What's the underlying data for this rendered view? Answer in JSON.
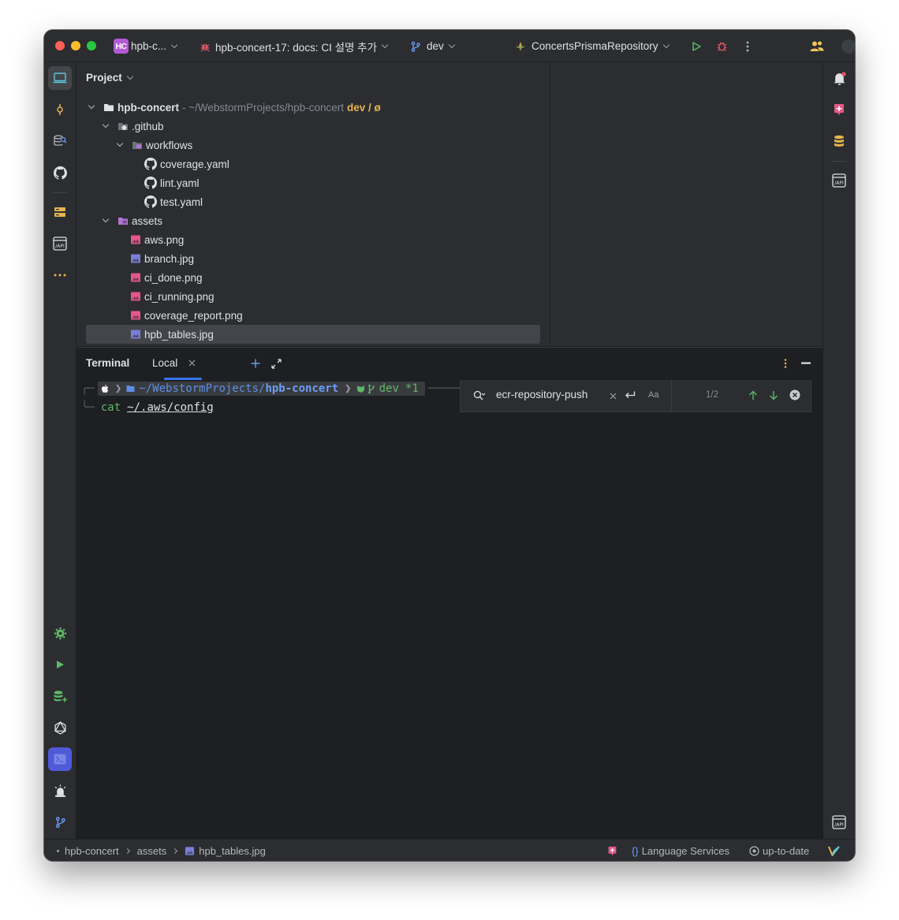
{
  "titlebar": {
    "project_badge": "HC",
    "project_name": "hpb-c...",
    "task": "hpb-concert-17: docs: CI 설명 추가",
    "branch": "dev",
    "run_config": "ConcertsPrismaRepository"
  },
  "project_panel": {
    "title": "Project",
    "root": {
      "name": "hpb-concert",
      "path": " - ~/WebstormProjects/hpb-concert",
      "vcs": "dev / ø"
    },
    "items": [
      {
        "label": ".github"
      },
      {
        "label": "workflows"
      },
      {
        "label": "coverage.yaml"
      },
      {
        "label": "lint.yaml"
      },
      {
        "label": "test.yaml"
      },
      {
        "label": "assets"
      },
      {
        "label": "aws.png"
      },
      {
        "label": "branch.jpg"
      },
      {
        "label": "ci_done.png"
      },
      {
        "label": "ci_running.png"
      },
      {
        "label": "coverage_report.png"
      },
      {
        "label": "hpb_tables.jpg"
      }
    ]
  },
  "terminal": {
    "title": "Terminal",
    "tab_label": "Local",
    "prompt": {
      "home": "~/WebstormProjects/",
      "dir": "hpb-concert",
      "branch": "dev",
      "status": "*1"
    },
    "command": {
      "cmd": "cat",
      "arg": "~/.aws/config"
    },
    "search": {
      "query": "ecr-repository-push",
      "case_label": "Aa",
      "count": "1/2"
    }
  },
  "statusbar": {
    "breadcrumb": [
      "hpb-concert",
      "assets",
      "hpb_tables.jpg"
    ],
    "language_services": "Language Services",
    "vcs_status": "up-to-date"
  },
  "colors": {
    "window_bg": "#1e1f22",
    "panel_bg": "#2b2d30",
    "selection": "#43454a",
    "accent_blue": "#3574f0",
    "terminal_path": "#5c8fe6",
    "terminal_branch": "#5fb865",
    "vcs_yellow": "#e6b450"
  }
}
